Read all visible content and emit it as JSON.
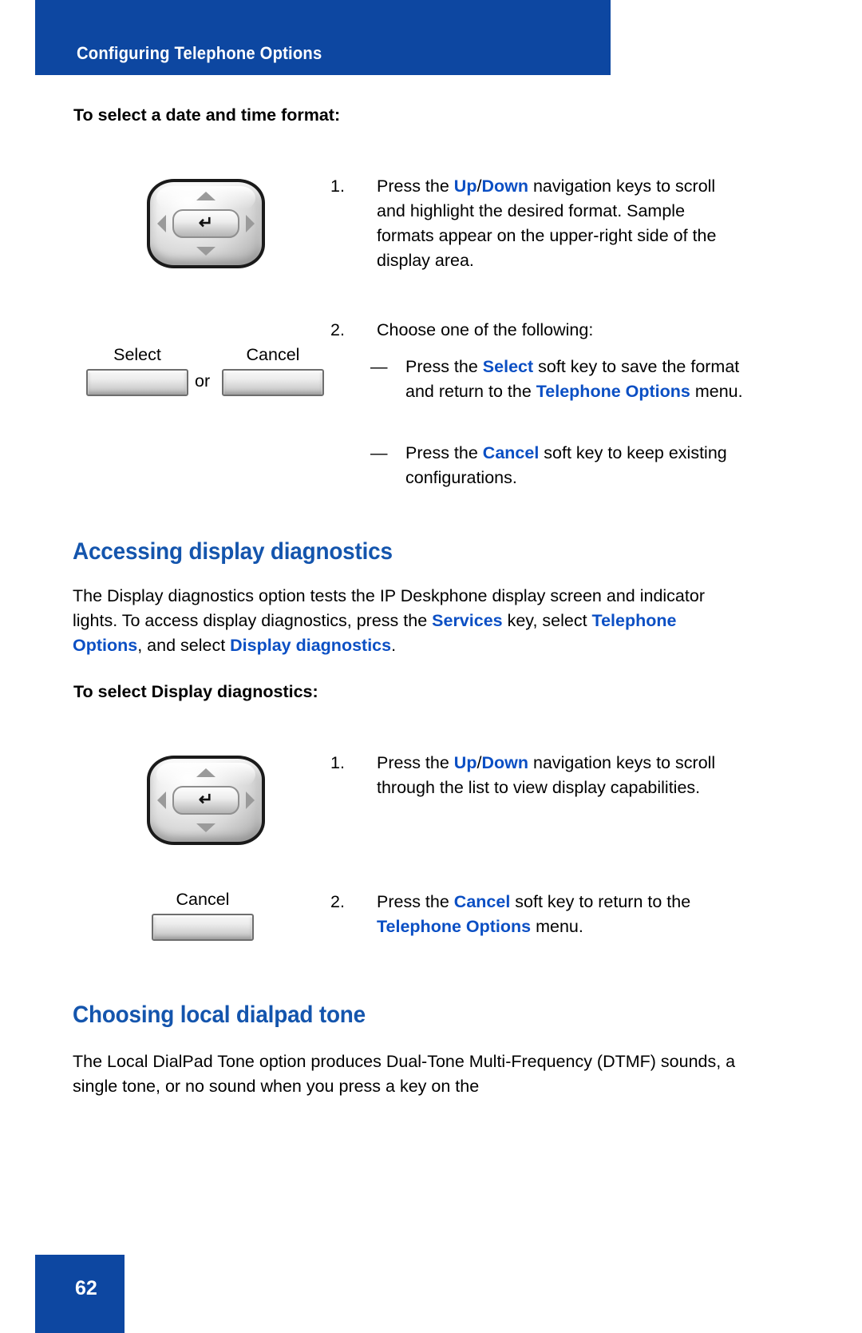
{
  "header": {
    "title": "Configuring Telephone Options",
    "band_color": "#0d47a1"
  },
  "footer": {
    "page_number": "62",
    "band_color": "#0d47a1"
  },
  "accent_color": "#0b4fc4",
  "icons": {
    "navigation_key": "navigation-cluster-key",
    "enter_glyph": "↵",
    "up_arrow": "▲",
    "down_arrow": "▼",
    "left_arrow": "◀",
    "right_arrow": "▶"
  },
  "sections": [
    {
      "id": "date-time-format",
      "procedure_title": "To select a date and time format:",
      "steps": [
        {
          "number": "1.",
          "parts": [
            {
              "text": "Press the ",
              "style": "plain"
            },
            {
              "text": "Up",
              "style": "bold-blue"
            },
            {
              "text": "/",
              "style": "plain"
            },
            {
              "text": "Down",
              "style": "bold-blue"
            },
            {
              "text": " navigation keys to scroll and highlight the desired format. Sample formats appear on the upper-right side of the display area.",
              "style": "plain"
            }
          ]
        },
        {
          "number": "2.",
          "parts": [
            {
              "text": "Choose one of the following:",
              "style": "plain"
            }
          ]
        }
      ],
      "bullets": [
        {
          "mark": "—",
          "parts": [
            {
              "text": "Press the ",
              "style": "plain"
            },
            {
              "text": "Select",
              "style": "bold-blue"
            },
            {
              "text": " soft key to save the format and return to the ",
              "style": "plain"
            },
            {
              "text": "Telephone Options",
              "style": "bold-blue"
            },
            {
              "text": " menu.",
              "style": "plain"
            }
          ]
        },
        {
          "mark": "—",
          "parts": [
            {
              "text": "Press the ",
              "style": "plain"
            },
            {
              "text": "Cancel",
              "style": "bold-blue"
            },
            {
              "text": " soft key to keep existing configurations.",
              "style": "plain"
            }
          ]
        }
      ],
      "softkeys": {
        "first_label": "Select",
        "separator": "or",
        "second_label": "Cancel"
      }
    },
    {
      "id": "display-diagnostics",
      "heading": "Accessing display diagnostics",
      "paragraph_parts": [
        {
          "text": "The Display diagnostics option tests the IP Deskphone display screen and indicator lights. To access display diagnostics, press the ",
          "style": "plain"
        },
        {
          "text": "Services",
          "style": "bold-blue"
        },
        {
          "text": " key, select ",
          "style": "plain"
        },
        {
          "text": "Telephone Options",
          "style": "bold-blue"
        },
        {
          "text": ", and select ",
          "style": "plain"
        },
        {
          "text": "Display diagnostics",
          "style": "bold-blue"
        },
        {
          "text": ".",
          "style": "plain"
        }
      ],
      "procedure_title": "To select Display diagnostics:",
      "steps": [
        {
          "number": "1.",
          "parts": [
            {
              "text": "Press the ",
              "style": "plain"
            },
            {
              "text": "Up",
              "style": "bold-blue"
            },
            {
              "text": "/",
              "style": "plain"
            },
            {
              "text": "Down",
              "style": "bold-blue"
            },
            {
              "text": " navigation keys to scroll through the list to view display capabilities.",
              "style": "plain"
            }
          ]
        },
        {
          "number": "2.",
          "parts": [
            {
              "text": "Press the ",
              "style": "plain"
            },
            {
              "text": "Cancel",
              "style": "bold-blue"
            },
            {
              "text": " soft key to return to the ",
              "style": "plain"
            },
            {
              "text": "Telephone Options",
              "style": "bold-blue"
            },
            {
              "text": " menu.",
              "style": "plain"
            }
          ]
        }
      ],
      "softkeys": {
        "first_label": "Cancel"
      }
    },
    {
      "id": "local-dialpad-tone",
      "heading": "Choosing local dialpad tone",
      "paragraph_parts": [
        {
          "text": "The Local DialPad Tone option produces Dual-Tone Multi-Frequency (DTMF) sounds, a single tone, or no sound when you press a key on the",
          "style": "plain"
        }
      ]
    }
  ]
}
